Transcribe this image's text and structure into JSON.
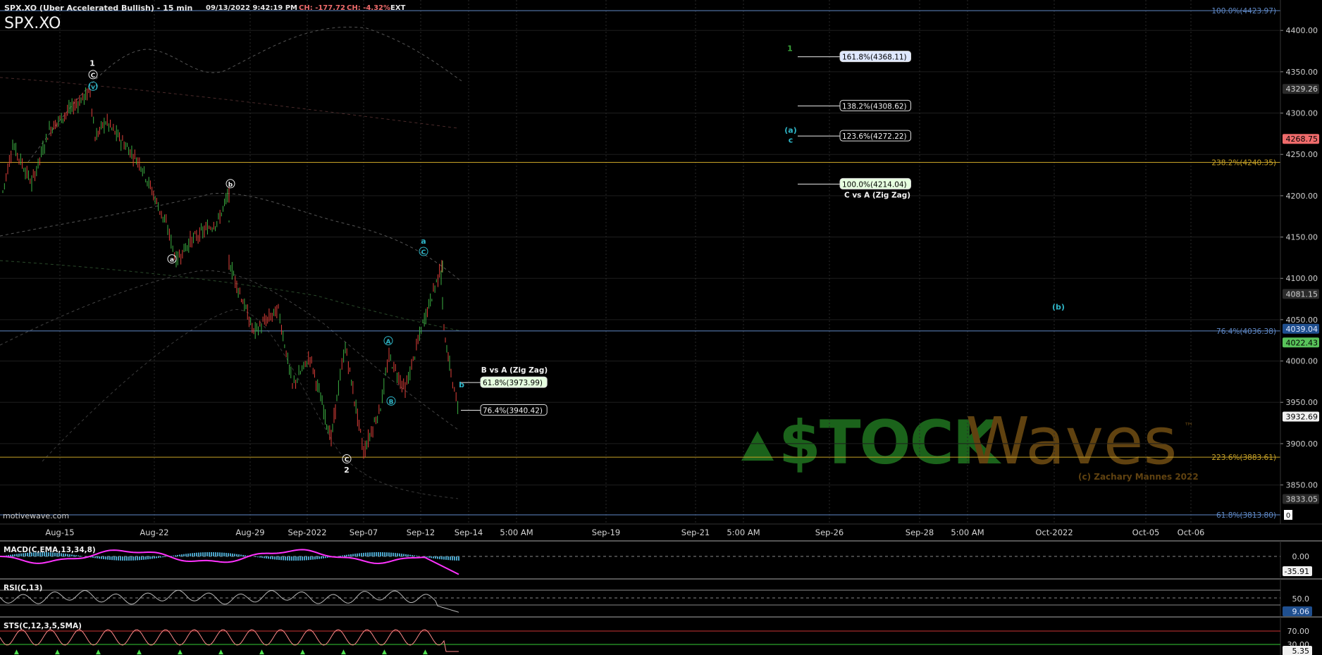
{
  "header": {
    "symbol_line": "SPX.XO (Uber Accelerated Bullish) - 15 min",
    "datetime": "09/13/2022 9:42:19 PM",
    "change_abs": "CH: -177.72",
    "change_pct": "CH: -4.32%",
    "session": "EXT",
    "symbol_big": "SPX.XO",
    "watermark_site": "motivewave.com"
  },
  "colors": {
    "background": "#000000",
    "up_candle": "#3cb043",
    "down_candle": "#e0403a",
    "fib_blue": "#5f89c7",
    "fib_orange": "#c8a227",
    "wave_cyan": "#2fb7c9",
    "macd_line": "#ff33ff",
    "macd_hist": "#4aa3c8",
    "rsi_line": "#b8b8b8",
    "stoch_line": "#ff8a8a",
    "stoch_mark": "#50e050",
    "price_badge_red": "#ef6b6b",
    "price_badge_green": "#58c35a",
    "logo_green": "#1f7a1f",
    "logo_brown": "#6b4a12"
  },
  "chart_data": {
    "type": "candlestick",
    "title": "SPX.XO (Uber Accelerated Bullish) - 15 min",
    "price_axis": {
      "ylim": [
        3813,
        4430
      ],
      "ticks": [
        "4400.00",
        "4350.00",
        "4300.00",
        "4250.00",
        "4200.00",
        "4150.00",
        "4100.00",
        "4050.00",
        "4000.00",
        "3950.00",
        "3900.00",
        "3850.00"
      ],
      "tick_values": [
        4400,
        4350,
        4300,
        4250,
        4200,
        4150,
        4100,
        4050,
        4000,
        3950,
        3900,
        3850
      ]
    },
    "x_axis_labels": [
      "Aug-15",
      "Aug-22",
      "Aug-29",
      "Sep-2022",
      "Sep-07",
      "Sep-12",
      "Sep-14",
      "5:00 AM",
      "Sep-19",
      "Sep-21",
      "5:00 AM",
      "Sep-26",
      "Sep-28",
      "5:00 AM",
      "Oct-2022",
      "Oct-05",
      "Oct-06"
    ],
    "price_path": [
      {
        "t": "Aug-11",
        "price": 4205
      },
      {
        "t": "Aug-12",
        "price": 4262
      },
      {
        "t": "Aug-13",
        "price": 4215
      },
      {
        "t": "Aug-15",
        "price": 4280
      },
      {
        "t": "Aug-16",
        "price": 4305
      },
      {
        "t": "Aug-17",
        "price": 4326
      },
      {
        "t": "Aug-17b",
        "price": 4270
      },
      {
        "t": "Aug-18",
        "price": 4290
      },
      {
        "t": "Aug-19",
        "price": 4238
      },
      {
        "t": "Aug-22",
        "price": 4160
      },
      {
        "t": "Aug-23",
        "price": 4122
      },
      {
        "t": "Aug-24",
        "price": 4145
      },
      {
        "t": "Aug-25",
        "price": 4170
      },
      {
        "t": "Aug-26",
        "price": 4203
      },
      {
        "t": "Aug-26b",
        "price": 4120
      },
      {
        "t": "Aug-29",
        "price": 4035
      },
      {
        "t": "Aug-30",
        "price": 4062
      },
      {
        "t": "Aug-31",
        "price": 3970
      },
      {
        "t": "Sep-01",
        "price": 4005
      },
      {
        "t": "Sep-02",
        "price": 3905
      },
      {
        "t": "Sep-02b",
        "price": 3955
      },
      {
        "t": "Sep-05",
        "price": 4018
      },
      {
        "t": "Sep-06",
        "price": 3890
      },
      {
        "t": "Sep-06b",
        "price": 3945
      },
      {
        "t": "Sep-07",
        "price": 4005
      },
      {
        "t": "Sep-08",
        "price": 3965
      },
      {
        "t": "Sep-09",
        "price": 4045
      },
      {
        "t": "Sep-10",
        "price": 4085
      },
      {
        "t": "Sep-12",
        "price": 4118
      },
      {
        "t": "Sep-12b",
        "price": 4100
      },
      {
        "t": "Sep-13",
        "price": 4038
      },
      {
        "t": "Sep-13b",
        "price": 3985
      },
      {
        "t": "Sep-13c",
        "price": 3932
      }
    ],
    "price_badges": [
      {
        "label": "4329.26",
        "value": 4329.26,
        "style": "gray"
      },
      {
        "label": "4268.75",
        "value": 4268.75,
        "style": "red"
      },
      {
        "label": "4081.15",
        "value": 4081.15,
        "style": "gray"
      },
      {
        "label": "4039.04",
        "value": 4039.04,
        "style": "blue"
      },
      {
        "label": "4022.43",
        "value": 4022.43,
        "style": "green"
      },
      {
        "label": "3932.69",
        "value": 3932.69,
        "style": "white"
      },
      {
        "label": "3833.05",
        "value": 3833.05,
        "style": "gray"
      }
    ],
    "fib_lines": [
      {
        "label": "100.0%(4423.97)",
        "value": 4423.97,
        "color": "blue"
      },
      {
        "label": "238.2%(4240.35)",
        "value": 4240.35,
        "color": "orange"
      },
      {
        "label": "76.4%(4036.38)",
        "value": 4036.38,
        "color": "blue"
      },
      {
        "label": "223.6%(3883.61)",
        "value": 3883.61,
        "color": "orange"
      },
      {
        "label": "61.8%(3813.80)",
        "value": 3813.8,
        "color": "blue"
      }
    ],
    "projection_c_vs_a": {
      "caption": "C vs A (Zig Zag)",
      "levels": [
        {
          "label": "161.8%(4368.11)",
          "value": 4368.11
        },
        {
          "label": "138.2%(4308.62)",
          "value": 4308.62
        },
        {
          "label": "123.6%(4272.22)",
          "value": 4272.22
        },
        {
          "label": "100.0%(4214.04)",
          "value": 4214.04
        }
      ]
    },
    "projection_b_vs_a": {
      "caption": "B vs A (Zig Zag)",
      "levels": [
        {
          "label": "61.8%(3973.99)",
          "value": 3973.99
        },
        {
          "label": "76.4%(3940.42)",
          "value": 3940.42
        }
      ]
    },
    "wave_labels": [
      {
        "text": "1",
        "value": 4358,
        "style": "white"
      },
      {
        "text": "C",
        "value": 4344,
        "style": "white-circle"
      },
      {
        "text": "(v)",
        "value": 4330,
        "style": "cyan-circle"
      },
      {
        "text": "b",
        "value": 4212,
        "style": "white-circle"
      },
      {
        "text": "a",
        "value": 4121,
        "style": "white-circle"
      },
      {
        "text": "a",
        "value": 4143,
        "style": "cyan"
      },
      {
        "text": "C",
        "value": 4130,
        "style": "cyan-circle"
      },
      {
        "text": "A",
        "value": 4022,
        "style": "cyan-circle"
      },
      {
        "text": "B",
        "value": 3949,
        "style": "cyan-circle"
      },
      {
        "text": "b",
        "value": 3969,
        "style": "cyan"
      },
      {
        "text": "C",
        "value": 3879,
        "style": "white-circle"
      },
      {
        "text": "2",
        "value": 3866,
        "style": "white"
      },
      {
        "text": "1",
        "value": 4376,
        "style": "green"
      },
      {
        "text": "(a)",
        "value": 4277,
        "style": "cyan"
      },
      {
        "text": "c",
        "value": 4265,
        "style": "cyan"
      },
      {
        "text": "(b)",
        "value": 4063,
        "style": "cyan"
      }
    ],
    "grid": true
  },
  "indicators": {
    "macd": {
      "label": "MACD(C,EMA,13,34,8)",
      "ticks": [
        "0.00"
      ],
      "value_badge": "-35.91"
    },
    "rsi": {
      "label": "RSI(C,13)",
      "ticks": [
        "50.0"
      ],
      "value_badge": "9.06"
    },
    "stoch": {
      "label": "STS(C,12,3,5,SMA)",
      "ticks": [
        "70.00",
        "30.00"
      ],
      "value_badge": "5.35"
    }
  },
  "logo": {
    "part1": "$TOCK",
    "part2": "Waves",
    "trademark": "™",
    "copyright": "(c) Zachary Mannes 2022"
  }
}
